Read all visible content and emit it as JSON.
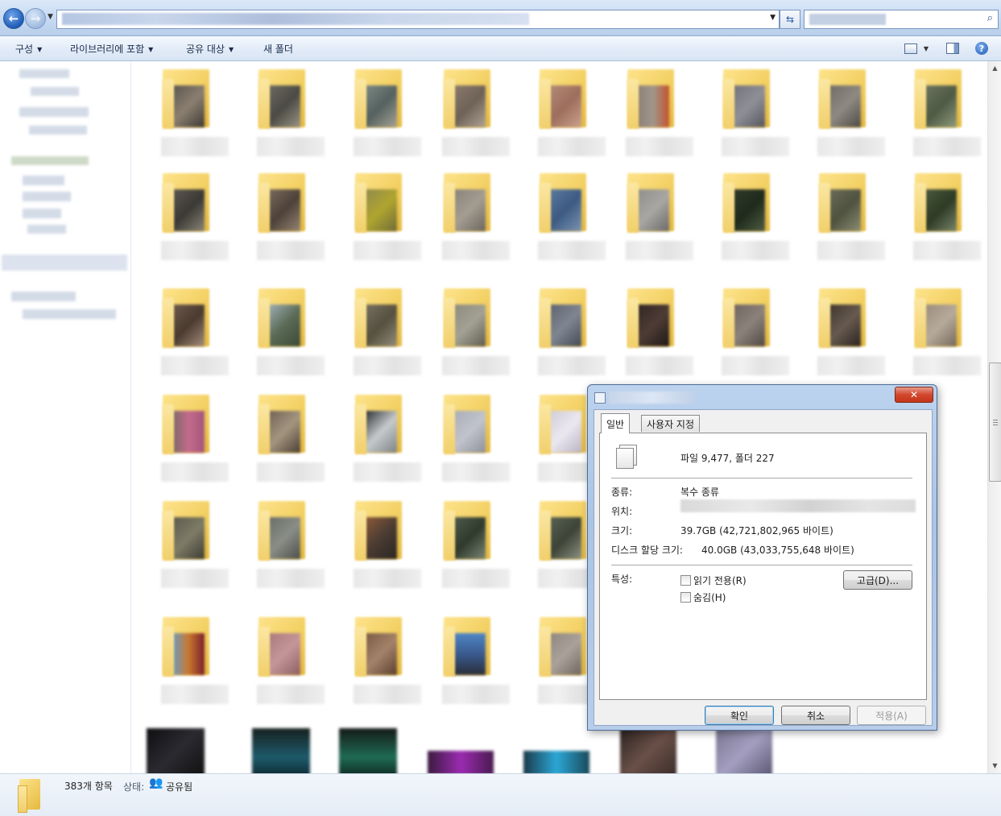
{
  "toolbar": {
    "organize": "구성",
    "include_in_library": "라이브러리에 포함",
    "share_with": "공유 대상",
    "new_folder": "새 폴더",
    "icons": [
      "views-icon",
      "preview-pane-icon",
      "help-icon"
    ]
  },
  "address": {
    "refresh_icon": "refresh-icon",
    "search_icon": "search-icon"
  },
  "status": {
    "item_count": "383개 항목",
    "state_label": "상태:",
    "state_value": "공유됨"
  },
  "dialog": {
    "tabs": [
      "일반",
      "사용자 지정"
    ],
    "summary": "파일 9,477, 폴더 227",
    "type_label": "종류:",
    "type_value": "복수 종류",
    "location_label": "위치:",
    "size_label": "크기:",
    "size_value": "39.7GB (42,721,802,965 바이트)",
    "disk_size_label": "디스크 할당 크기:",
    "disk_size_value": "40.0GB (43,033,755,648 바이트)",
    "attributes_label": "특성:",
    "readonly_label": "읽기 전용(R)",
    "readonly_checked": false,
    "hidden_label": "숨김(H)",
    "hidden_checked": false,
    "advanced_button": "고급(D)...",
    "ok_button": "확인",
    "cancel_button": "취소",
    "apply_button": "적용(A)",
    "close_glyph": "✕"
  },
  "colors": {
    "folder_yellow": "#f1cd5d",
    "title_blue": "#a9c4e6",
    "close_red": "#d2472d"
  }
}
